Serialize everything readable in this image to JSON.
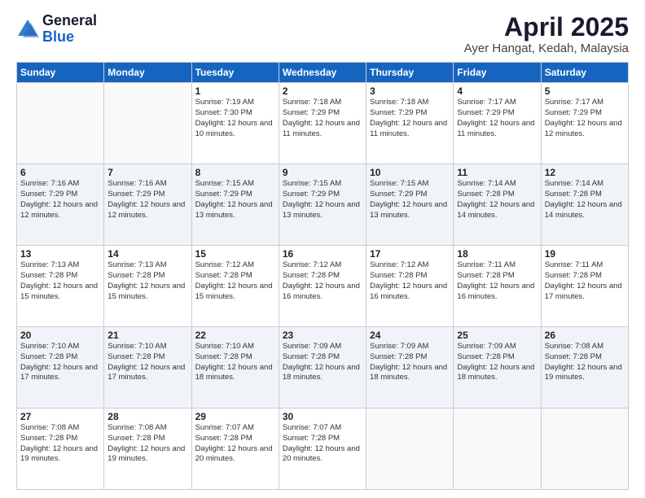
{
  "logo": {
    "general": "General",
    "blue": "Blue"
  },
  "header": {
    "month": "April 2025",
    "location": "Ayer Hangat, Kedah, Malaysia"
  },
  "weekdays": [
    "Sunday",
    "Monday",
    "Tuesday",
    "Wednesday",
    "Thursday",
    "Friday",
    "Saturday"
  ],
  "weeks": [
    [
      {
        "day": "",
        "sunrise": "",
        "sunset": "",
        "daylight": ""
      },
      {
        "day": "",
        "sunrise": "",
        "sunset": "",
        "daylight": ""
      },
      {
        "day": "1",
        "sunrise": "Sunrise: 7:19 AM",
        "sunset": "Sunset: 7:30 PM",
        "daylight": "Daylight: 12 hours and 10 minutes."
      },
      {
        "day": "2",
        "sunrise": "Sunrise: 7:18 AM",
        "sunset": "Sunset: 7:29 PM",
        "daylight": "Daylight: 12 hours and 11 minutes."
      },
      {
        "day": "3",
        "sunrise": "Sunrise: 7:18 AM",
        "sunset": "Sunset: 7:29 PM",
        "daylight": "Daylight: 12 hours and 11 minutes."
      },
      {
        "day": "4",
        "sunrise": "Sunrise: 7:17 AM",
        "sunset": "Sunset: 7:29 PM",
        "daylight": "Daylight: 12 hours and 11 minutes."
      },
      {
        "day": "5",
        "sunrise": "Sunrise: 7:17 AM",
        "sunset": "Sunset: 7:29 PM",
        "daylight": "Daylight: 12 hours and 12 minutes."
      }
    ],
    [
      {
        "day": "6",
        "sunrise": "Sunrise: 7:16 AM",
        "sunset": "Sunset: 7:29 PM",
        "daylight": "Daylight: 12 hours and 12 minutes."
      },
      {
        "day": "7",
        "sunrise": "Sunrise: 7:16 AM",
        "sunset": "Sunset: 7:29 PM",
        "daylight": "Daylight: 12 hours and 12 minutes."
      },
      {
        "day": "8",
        "sunrise": "Sunrise: 7:15 AM",
        "sunset": "Sunset: 7:29 PM",
        "daylight": "Daylight: 12 hours and 13 minutes."
      },
      {
        "day": "9",
        "sunrise": "Sunrise: 7:15 AM",
        "sunset": "Sunset: 7:29 PM",
        "daylight": "Daylight: 12 hours and 13 minutes."
      },
      {
        "day": "10",
        "sunrise": "Sunrise: 7:15 AM",
        "sunset": "Sunset: 7:29 PM",
        "daylight": "Daylight: 12 hours and 13 minutes."
      },
      {
        "day": "11",
        "sunrise": "Sunrise: 7:14 AM",
        "sunset": "Sunset: 7:28 PM",
        "daylight": "Daylight: 12 hours and 14 minutes."
      },
      {
        "day": "12",
        "sunrise": "Sunrise: 7:14 AM",
        "sunset": "Sunset: 7:28 PM",
        "daylight": "Daylight: 12 hours and 14 minutes."
      }
    ],
    [
      {
        "day": "13",
        "sunrise": "Sunrise: 7:13 AM",
        "sunset": "Sunset: 7:28 PM",
        "daylight": "Daylight: 12 hours and 15 minutes."
      },
      {
        "day": "14",
        "sunrise": "Sunrise: 7:13 AM",
        "sunset": "Sunset: 7:28 PM",
        "daylight": "Daylight: 12 hours and 15 minutes."
      },
      {
        "day": "15",
        "sunrise": "Sunrise: 7:12 AM",
        "sunset": "Sunset: 7:28 PM",
        "daylight": "Daylight: 12 hours and 15 minutes."
      },
      {
        "day": "16",
        "sunrise": "Sunrise: 7:12 AM",
        "sunset": "Sunset: 7:28 PM",
        "daylight": "Daylight: 12 hours and 16 minutes."
      },
      {
        "day": "17",
        "sunrise": "Sunrise: 7:12 AM",
        "sunset": "Sunset: 7:28 PM",
        "daylight": "Daylight: 12 hours and 16 minutes."
      },
      {
        "day": "18",
        "sunrise": "Sunrise: 7:11 AM",
        "sunset": "Sunset: 7:28 PM",
        "daylight": "Daylight: 12 hours and 16 minutes."
      },
      {
        "day": "19",
        "sunrise": "Sunrise: 7:11 AM",
        "sunset": "Sunset: 7:28 PM",
        "daylight": "Daylight: 12 hours and 17 minutes."
      }
    ],
    [
      {
        "day": "20",
        "sunrise": "Sunrise: 7:10 AM",
        "sunset": "Sunset: 7:28 PM",
        "daylight": "Daylight: 12 hours and 17 minutes."
      },
      {
        "day": "21",
        "sunrise": "Sunrise: 7:10 AM",
        "sunset": "Sunset: 7:28 PM",
        "daylight": "Daylight: 12 hours and 17 minutes."
      },
      {
        "day": "22",
        "sunrise": "Sunrise: 7:10 AM",
        "sunset": "Sunset: 7:28 PM",
        "daylight": "Daylight: 12 hours and 18 minutes."
      },
      {
        "day": "23",
        "sunrise": "Sunrise: 7:09 AM",
        "sunset": "Sunset: 7:28 PM",
        "daylight": "Daylight: 12 hours and 18 minutes."
      },
      {
        "day": "24",
        "sunrise": "Sunrise: 7:09 AM",
        "sunset": "Sunset: 7:28 PM",
        "daylight": "Daylight: 12 hours and 18 minutes."
      },
      {
        "day": "25",
        "sunrise": "Sunrise: 7:09 AM",
        "sunset": "Sunset: 7:28 PM",
        "daylight": "Daylight: 12 hours and 18 minutes."
      },
      {
        "day": "26",
        "sunrise": "Sunrise: 7:08 AM",
        "sunset": "Sunset: 7:28 PM",
        "daylight": "Daylight: 12 hours and 19 minutes."
      }
    ],
    [
      {
        "day": "27",
        "sunrise": "Sunrise: 7:08 AM",
        "sunset": "Sunset: 7:28 PM",
        "daylight": "Daylight: 12 hours and 19 minutes."
      },
      {
        "day": "28",
        "sunrise": "Sunrise: 7:08 AM",
        "sunset": "Sunset: 7:28 PM",
        "daylight": "Daylight: 12 hours and 19 minutes."
      },
      {
        "day": "29",
        "sunrise": "Sunrise: 7:07 AM",
        "sunset": "Sunset: 7:28 PM",
        "daylight": "Daylight: 12 hours and 20 minutes."
      },
      {
        "day": "30",
        "sunrise": "Sunrise: 7:07 AM",
        "sunset": "Sunset: 7:28 PM",
        "daylight": "Daylight: 12 hours and 20 minutes."
      },
      {
        "day": "",
        "sunrise": "",
        "sunset": "",
        "daylight": ""
      },
      {
        "day": "",
        "sunrise": "",
        "sunset": "",
        "daylight": ""
      },
      {
        "day": "",
        "sunrise": "",
        "sunset": "",
        "daylight": ""
      }
    ]
  ]
}
